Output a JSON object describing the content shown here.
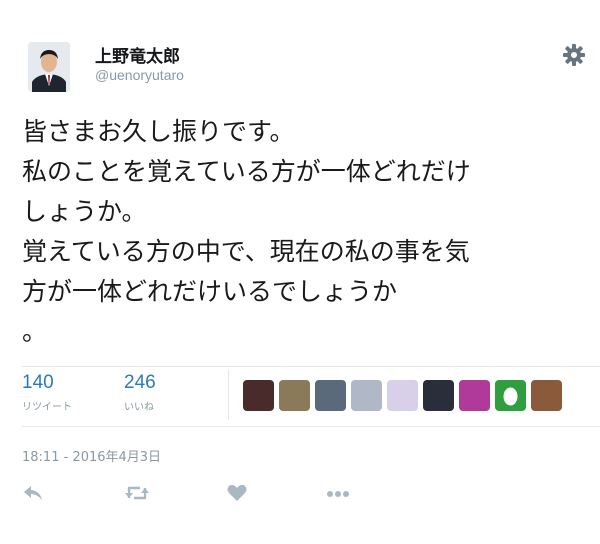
{
  "user": {
    "display_name": "上野竜太郎",
    "handle": "@uenoryutaro"
  },
  "tweet": {
    "lines": [
      "皆さまお久し振りです。",
      "私のことを覚えている方が一体どれだけ",
      "しょうか。",
      "覚えている方の中で、現在の私の事を気",
      "方が一体どれだけいるでしょうか",
      "。"
    ]
  },
  "stats": {
    "retweets": {
      "count": "140",
      "label": "リツイート"
    },
    "likes": {
      "count": "246",
      "label": "いいね"
    }
  },
  "timestamp": "18:11 - 2016年4月3日",
  "liker_avatars": [
    {
      "icon": "avatar-dark-couple",
      "color": "#4a2b2b"
    },
    {
      "icon": "avatar-cats",
      "color": "#8a7a5a"
    },
    {
      "icon": "avatar-man-suit",
      "color": "#5a6a7a"
    },
    {
      "icon": "avatar-illustration",
      "color": "#b0b8c8"
    },
    {
      "icon": "avatar-flowers",
      "color": "#d8d0e8"
    },
    {
      "icon": "avatar-dark-figure",
      "color": "#2a2e3a"
    },
    {
      "icon": "avatar-purple",
      "color": "#b03a9a"
    },
    {
      "icon": "avatar-default-egg",
      "color": "#2e9e3e"
    },
    {
      "icon": "avatar-brown-animal",
      "color": "#8a5a3a"
    }
  ],
  "colors": {
    "link_blue": "#2b7bb9",
    "muted_gray": "#8899a6",
    "icon_gray": "#aab8c2",
    "divider": "#e1e8ed"
  }
}
